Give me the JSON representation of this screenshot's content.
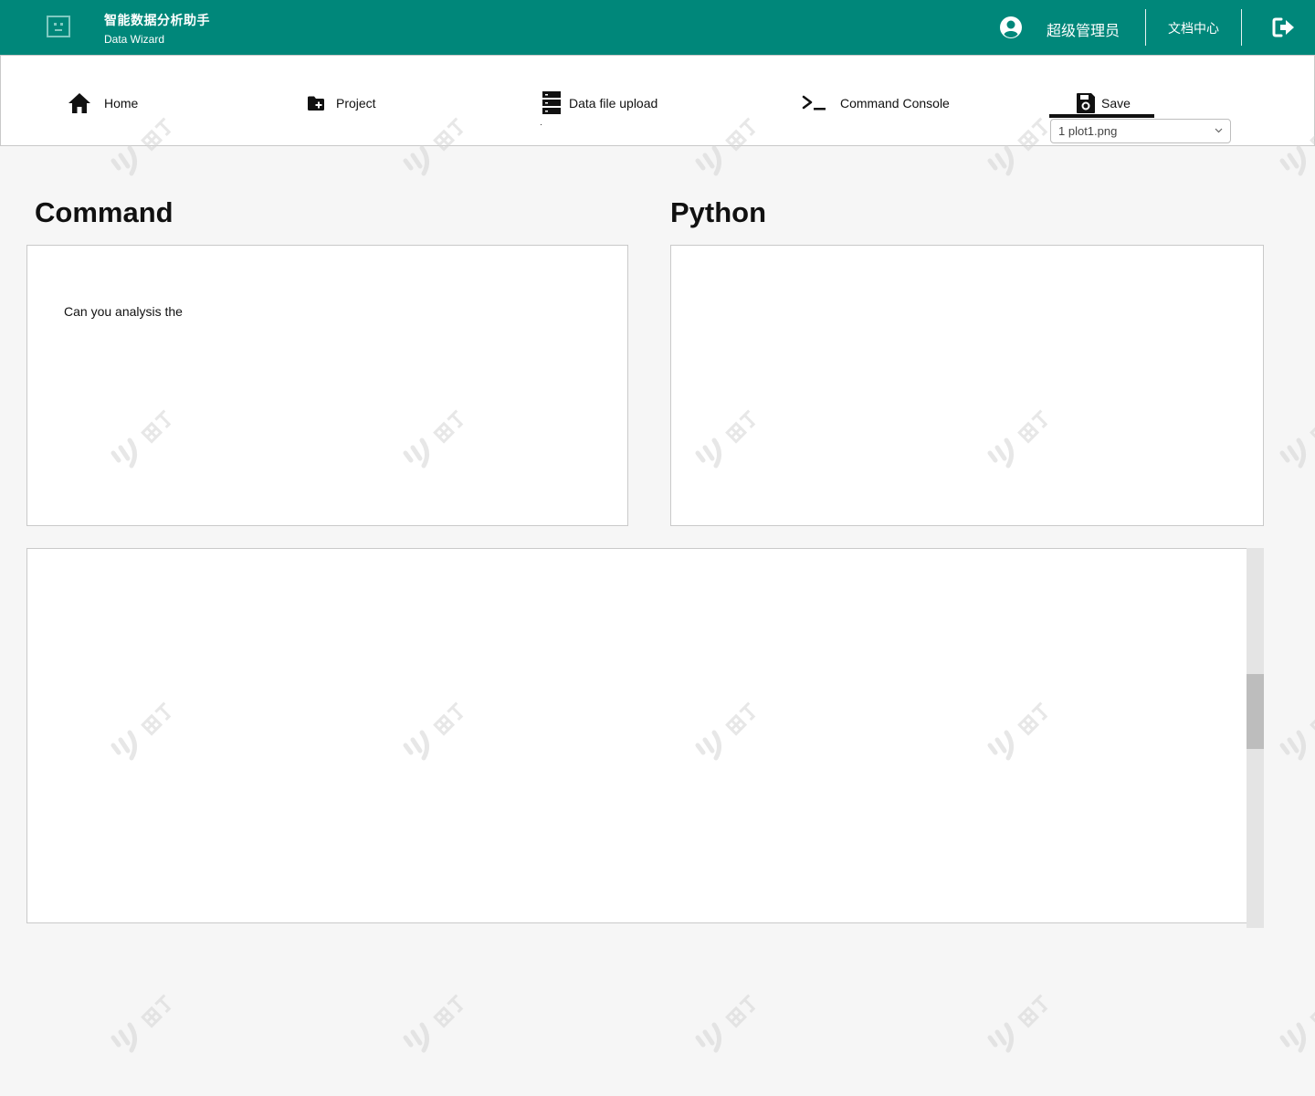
{
  "header": {
    "app_title": "智能数据分析助手",
    "app_subtitle": "Data Wizard",
    "user_name": "超级管理员",
    "docs_link": "文档中心",
    "brand_color": "#00877a"
  },
  "nav": {
    "items": [
      {
        "label": "Home",
        "icon": "home-icon"
      },
      {
        "label": "Project",
        "icon": "folder-plus-icon"
      },
      {
        "label": "Data file upload",
        "icon": "server-icon"
      },
      {
        "label": "Command Console",
        "icon": "terminal-icon"
      },
      {
        "label": "Save",
        "icon": "save-icon",
        "active": true
      }
    ],
    "file_select_value": "1 plot1.png"
  },
  "command": {
    "title": "Command",
    "text": "Can you analysis the"
  },
  "python": {
    "title": "Python"
  }
}
